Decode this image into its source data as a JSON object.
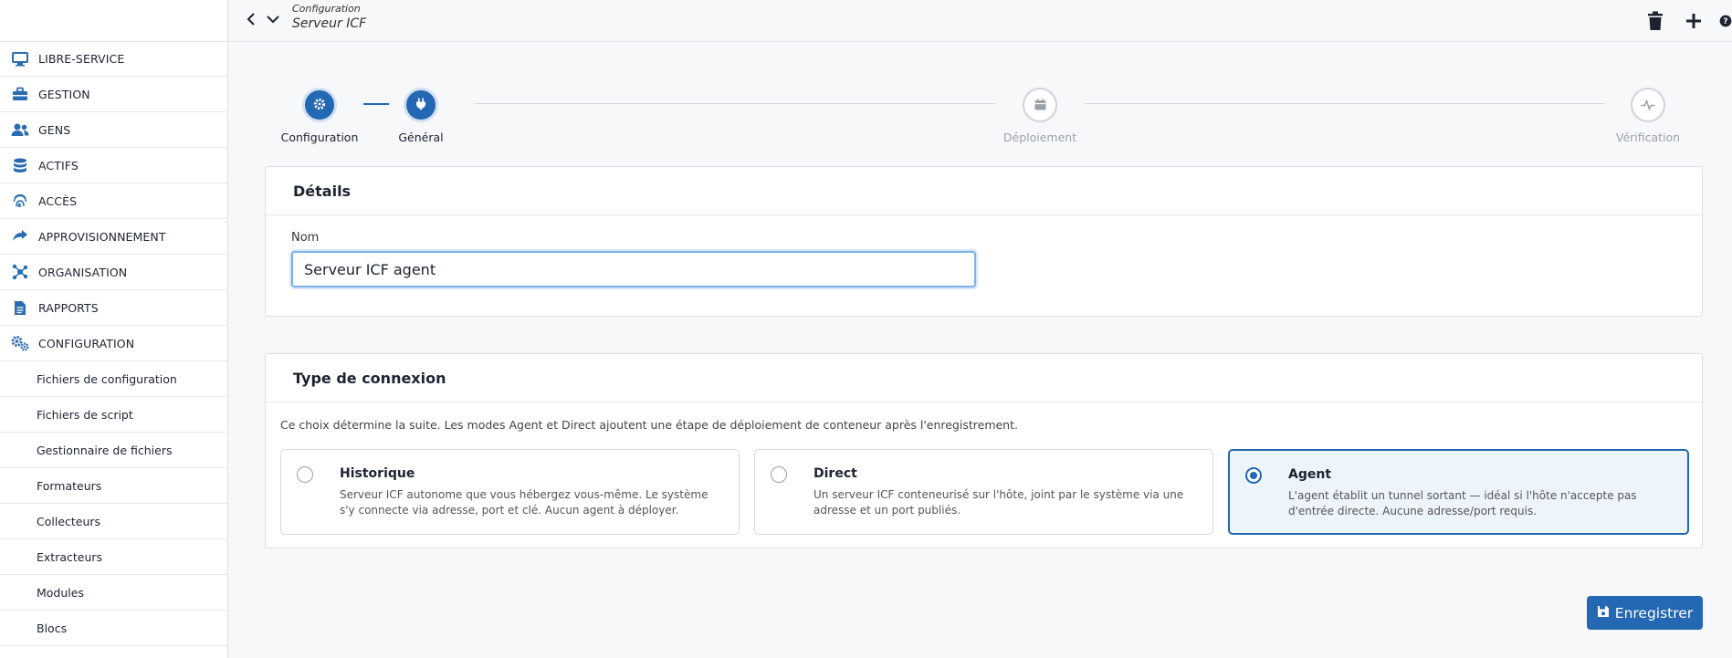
{
  "topbar": {
    "breadcrumb_parent": "Configuration",
    "breadcrumb_current": "Serveur ICF"
  },
  "sidebar": {
    "items": [
      {
        "label": "LIBRE-SERVICE",
        "icon": "monitor-icon"
      },
      {
        "label": "GESTION",
        "icon": "toolbox-icon"
      },
      {
        "label": "GENS",
        "icon": "users-icon"
      },
      {
        "label": "ACTIFS",
        "icon": "database-icon"
      },
      {
        "label": "ACCÈS",
        "icon": "fingerprint-icon"
      },
      {
        "label": "APPROVISIONNEMENT",
        "icon": "share-arrow-icon"
      },
      {
        "label": "ORGANISATION",
        "icon": "network-icon"
      },
      {
        "label": "RAPPORTS",
        "icon": "file-text-icon"
      },
      {
        "label": "CONFIGURATION",
        "icon": "cogs-icon"
      }
    ],
    "sub_items": [
      "Fichiers de configuration",
      "Fichiers de script",
      "Gestionnaire de fichiers",
      "Formateurs",
      "Collecteurs",
      "Extracteurs",
      "Modules",
      "Blocs"
    ]
  },
  "stepper": {
    "steps": [
      {
        "label": "Configuration",
        "icon": "gear-icon",
        "state": "active"
      },
      {
        "label": "Général",
        "icon": "plug-icon",
        "state": "active"
      },
      {
        "label": "Déploiement",
        "icon": "calendar-icon",
        "state": "inactive"
      },
      {
        "label": "Vérification",
        "icon": "heartbeat-icon",
        "state": "inactive"
      }
    ]
  },
  "details": {
    "title": "Détails",
    "name_label": "Nom",
    "name_value": "Serveur ICF agent"
  },
  "connection": {
    "title": "Type de connexion",
    "help": "Ce choix détermine la suite. Les modes Agent et Direct ajoutent une étape de déploiement de conteneur après l'enregistrement.",
    "options": [
      {
        "title": "Historique",
        "desc": "Serveur ICF autonome que vous hébergez vous-même. Le système s'y connecte via adresse, port et clé. Aucun agent à déployer.",
        "selected": false
      },
      {
        "title": "Direct",
        "desc": "Un serveur ICF conteneurisé sur l'hôte, joint par le système via une adresse et un port publiés.",
        "selected": false
      },
      {
        "title": "Agent",
        "desc": "L'agent établit un tunnel sortant — idéal si l'hôte n'accepte pas d'entrée directe. Aucune adresse/port requis.",
        "selected": true
      }
    ]
  },
  "actions": {
    "save_label": "Enregistrer"
  },
  "colors": {
    "accent": "#2467b3",
    "selected_bg": "#eef4fb"
  }
}
